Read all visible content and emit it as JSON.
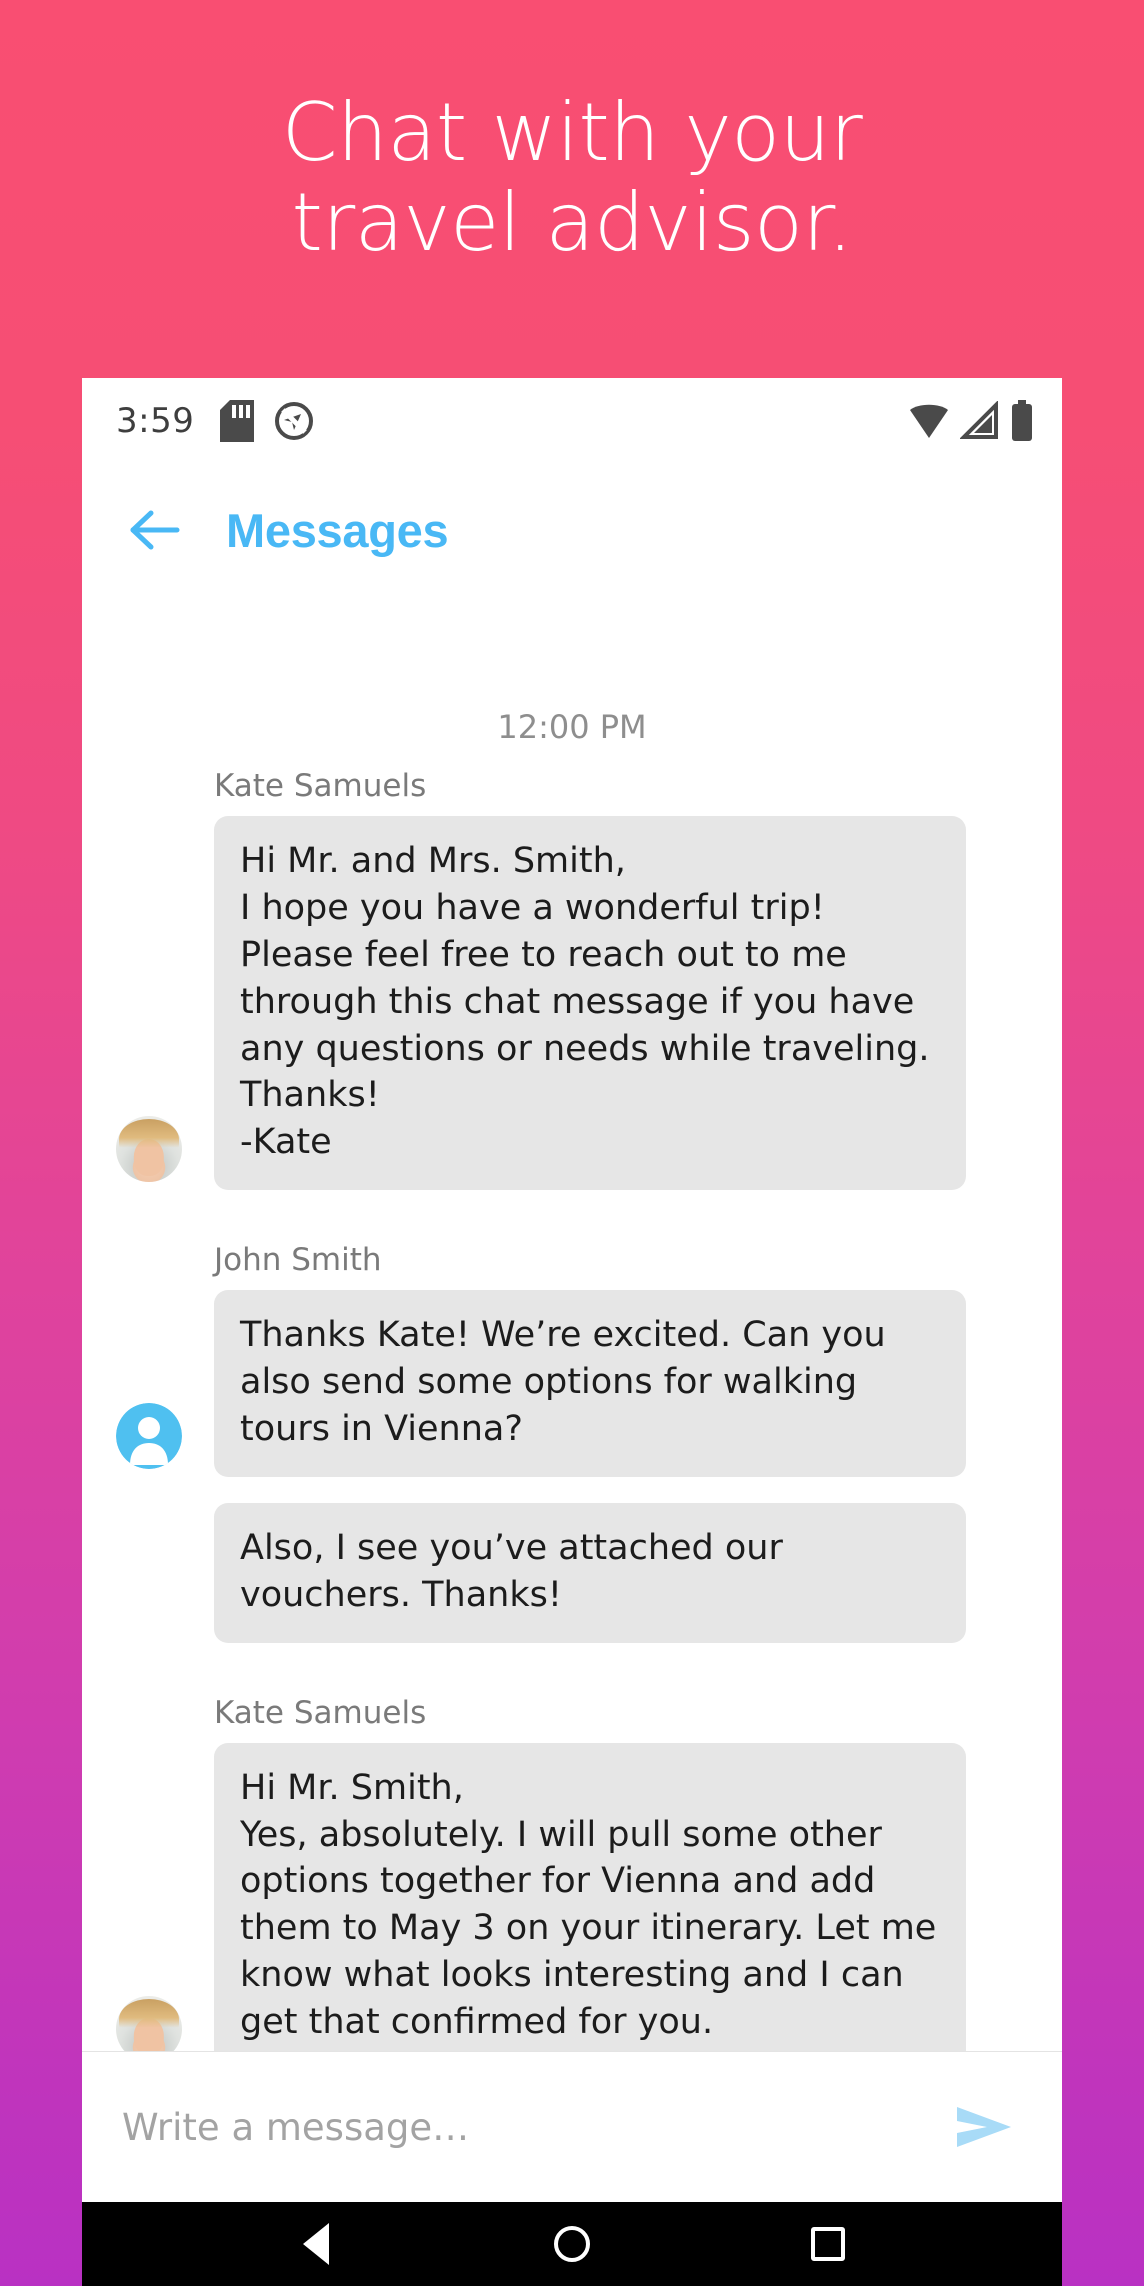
{
  "poster": {
    "headline": "Chat with your\ntravel advisor.",
    "gradient_top": "#f94e72",
    "gradient_bottom": "#b931c3"
  },
  "statusbar": {
    "time": "3:59",
    "left_icons": [
      "sd-card-icon",
      "location-off-icon"
    ],
    "right_icons": [
      "wifi-icon",
      "cell-signal-icon",
      "battery-icon"
    ]
  },
  "appbar": {
    "back_icon": "arrow-left-icon",
    "title": "Messages",
    "accent_color": "#49b8f5"
  },
  "thread": {
    "timestamp": "12:00 PM",
    "messages": [
      {
        "sender": "Kate Samuels",
        "avatar": "kate-photo",
        "show_name": true,
        "text": "Hi Mr. and Mrs. Smith,\nI hope you have a wonderful trip! Please feel free to reach out to me through this chat message if you have any questions or needs while traveling.\nThanks!\n-Kate"
      },
      {
        "sender": "John Smith",
        "avatar": "person-icon",
        "show_name": true,
        "text": "Thanks Kate! We’re excited. Can you also send some options for walking tours in Vienna?"
      },
      {
        "sender": "John Smith",
        "avatar": "none",
        "show_name": false,
        "text": "Also, I see you’ve attached our vouchers. Thanks!"
      },
      {
        "sender": "Kate Samuels",
        "avatar": "kate-photo",
        "show_name": true,
        "text": "Hi Mr. Smith,\nYes, absolutely. I will pull some other options together for Vienna and add them to May 3 on your itinerary. Let me know what looks interesting and I can get that confirmed for you."
      }
    ]
  },
  "composer": {
    "placeholder": "Write a message…",
    "value": "",
    "send_icon": "send-icon",
    "send_color": "#a8dbf7"
  },
  "navbar": {
    "back_label": "back-triangle",
    "home_label": "home-circle",
    "recents_label": "recents-square"
  }
}
